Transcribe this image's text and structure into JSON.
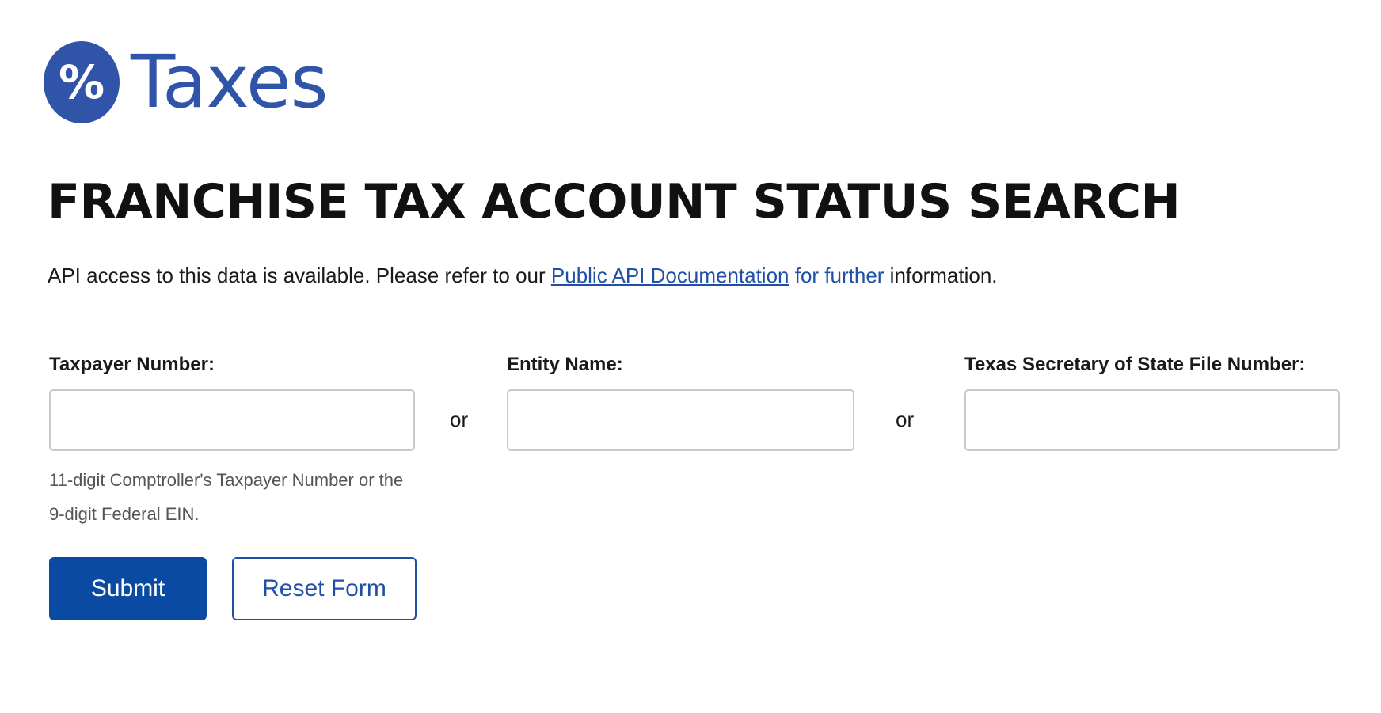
{
  "logo": {
    "symbol": "%",
    "text": "Taxes",
    "brand_color": "#2f54a8"
  },
  "page_title": "FRANCHISE TAX ACCOUNT STATUS SEARCH",
  "info": {
    "prefix": "API access to this data is available. Please refer to our ",
    "link_text": "Public API Documentation",
    "link_continuation": " for further",
    "suffix": " information."
  },
  "form": {
    "taxpayer_number": {
      "label": "Taxpayer Number:",
      "value": "",
      "hint": "11-digit Comptroller's Taxpayer Number or the 9-digit Federal EIN."
    },
    "separator_1": "or",
    "entity_name": {
      "label": "Entity Name:",
      "value": ""
    },
    "separator_2": "or",
    "sos_file_number": {
      "label": "Texas Secretary of State File Number:",
      "value": ""
    },
    "submit_label": "Submit",
    "reset_label": "Reset Form"
  },
  "colors": {
    "primary_button": "#0b4aa2",
    "link": "#1f4fa6",
    "input_border": "#c9c9c9"
  }
}
